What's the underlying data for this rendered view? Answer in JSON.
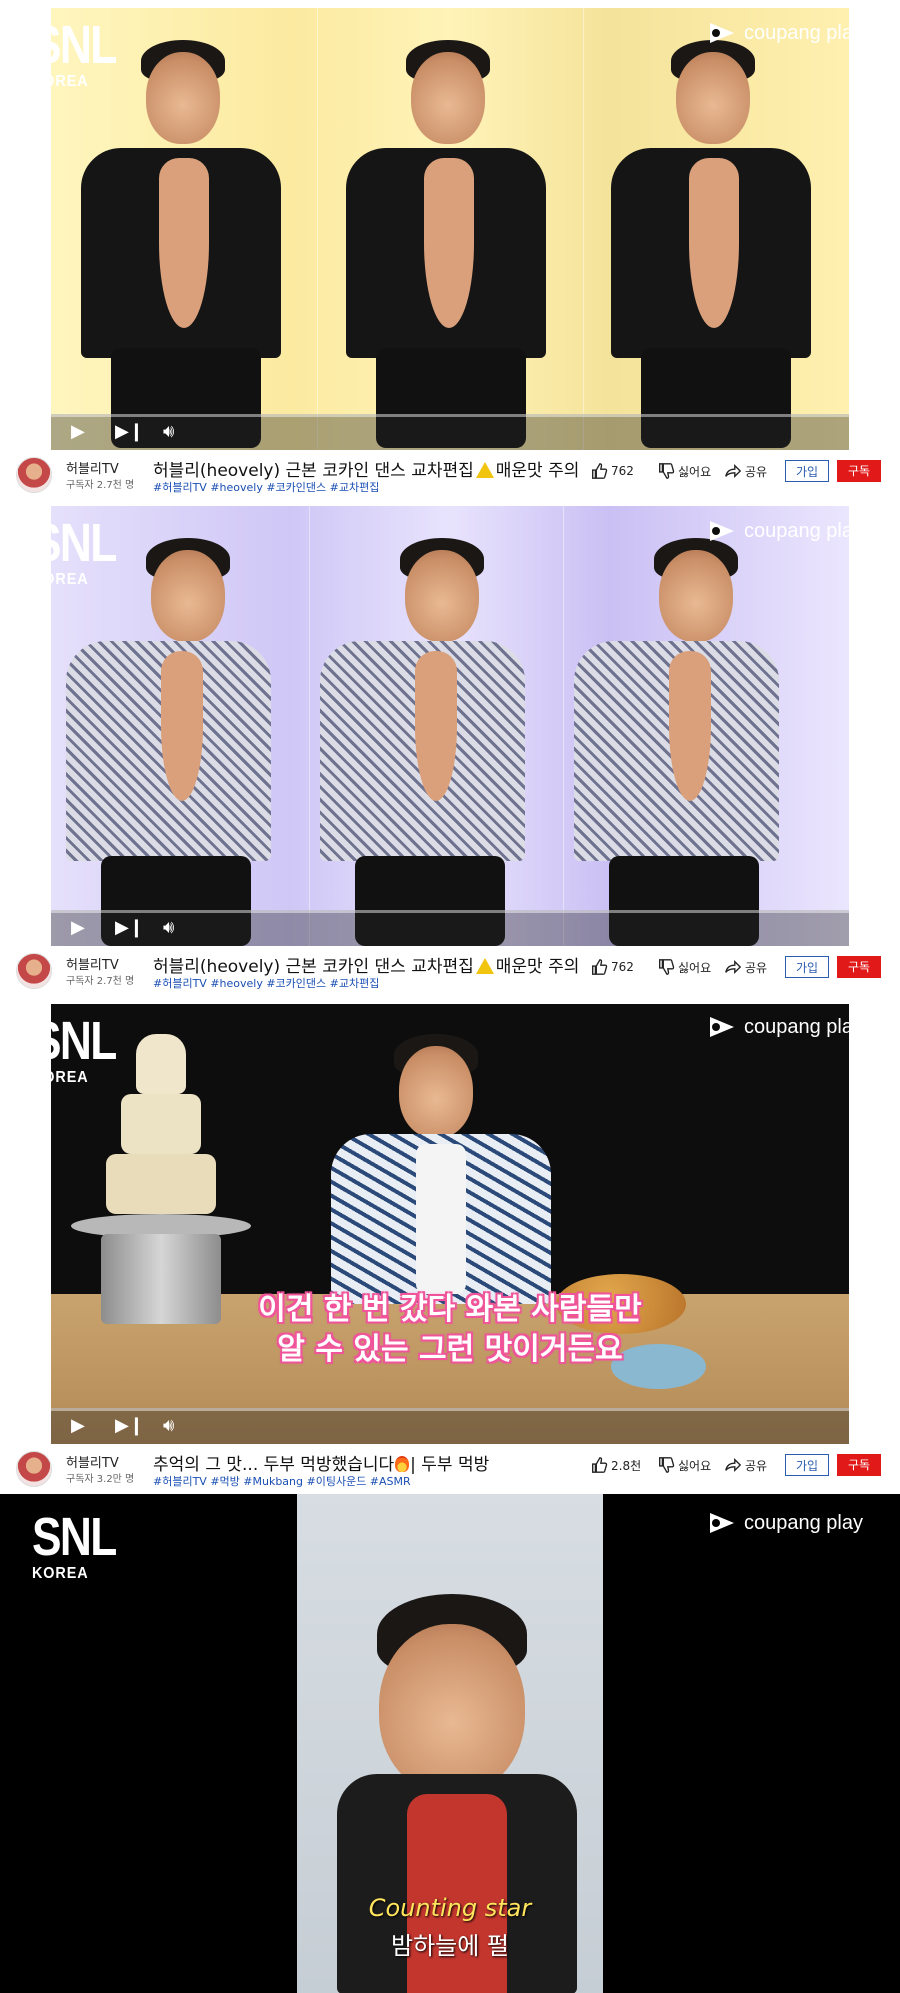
{
  "watermarks": {
    "snl_main": "SNL",
    "snl_sub": "KOREA",
    "coupang": "coupang play"
  },
  "panels": [
    {
      "channel_name": "허블리TV",
      "channel_subs": "구독자 2.7천 명",
      "title_a": "허블리(heovely) 근본 코카인 댄스 교차편집",
      "title_b": "매운맛 주의",
      "tags": "#허블리TV #heovely #코카인댄스 #교차편집",
      "likes": "762",
      "dislike_label": "싫어요",
      "share_label": "공유",
      "join_label": "가입",
      "subscribe_label": "구독"
    },
    {
      "channel_name": "허블리TV",
      "channel_subs": "구독자 2.7천 명",
      "title_a": "허블리(heovely) 근본 코카인 댄스 교차편집",
      "title_b": "매운맛 주의",
      "tags": "#허블리TV #heovely #코카인댄스 #교차편집",
      "likes": "762",
      "dislike_label": "싫어요",
      "share_label": "공유",
      "join_label": "가입",
      "subscribe_label": "구독"
    },
    {
      "channel_name": "허블리TV",
      "channel_subs": "구독자 3.2만 명",
      "title_a": "추억의 그 맛... 두부 먹방했습니다",
      "title_b": "| 두부 먹방",
      "tags": "#허블리TV #먹방 #Mukbang #이팅사운드 #ASMR",
      "likes": "2.8천",
      "dislike_label": "싫어요",
      "share_label": "공유",
      "join_label": "가입",
      "subscribe_label": "구독",
      "caption_line1": "이건 한 번 갔다 와본 사람들만",
      "caption_line2": "알 수 있는 그런 맛이거든요"
    }
  ],
  "panel4": {
    "subtitle_en": "Counting star",
    "subtitle_ko": "밤하늘에 펄"
  },
  "colors": {
    "subscribe": "#e11919",
    "join": "#2a5db0",
    "tags": "#1a4fb3"
  }
}
